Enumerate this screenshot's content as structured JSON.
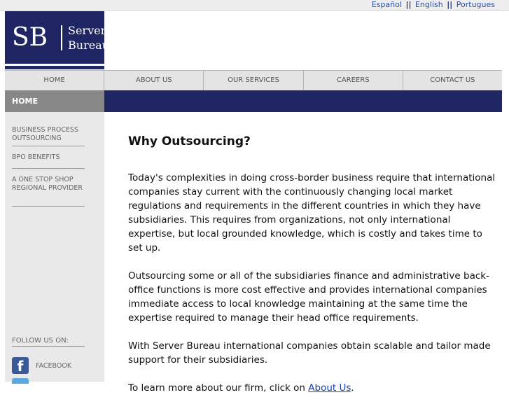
{
  "lang": {
    "espanol": "Español",
    "english": "English",
    "portugues": "Portugues",
    "separator": "||"
  },
  "logo": {
    "initials": "SB",
    "word1": "Server",
    "word2": "Bureau"
  },
  "nav": {
    "items": [
      "HOME",
      "ABOUT US",
      "OUR SERVICES",
      "CAREERS",
      "CONTACT US"
    ]
  },
  "subheader": {
    "label": "HOME"
  },
  "sidebar": {
    "items": [
      "BUSINESS PROCESS OUTSOURCING",
      "BPO BENEFITS",
      "A ONE STOP SHOP REGIONAL PROVIDER"
    ],
    "follow_label": "FOLLOW US ON:",
    "facebook_label": "FACEBOOK"
  },
  "content": {
    "title": "Why Outsourcing?",
    "p1": "Today's complexities in doing cross-border business require that international companies stay current with the continuously changing local market regulations and requirements in the different countries in which they have subsidiaries.  This requires from organizations, not only international expertise, but local grounded knowledge, which is costly and takes time to set up.",
    "p2": "Outsourcing some or all of the subsidiaries finance and administrative back-office functions is more cost effective and provides international companies immediate access to local knowledge maintaining at the same time the expertise required to manage their head office requirements.",
    "p3": "With Server Bureau international companies obtain scalable and tailor made support for their subsidiaries.",
    "p4_prefix": "To learn more about our firm, click on ",
    "p4_link": "About Us",
    "p4_suffix": "."
  },
  "colors": {
    "brand_navy": "#1f2663",
    "link_blue": "#1a3fb0",
    "sidebar_gray": "#e9e9e9"
  }
}
